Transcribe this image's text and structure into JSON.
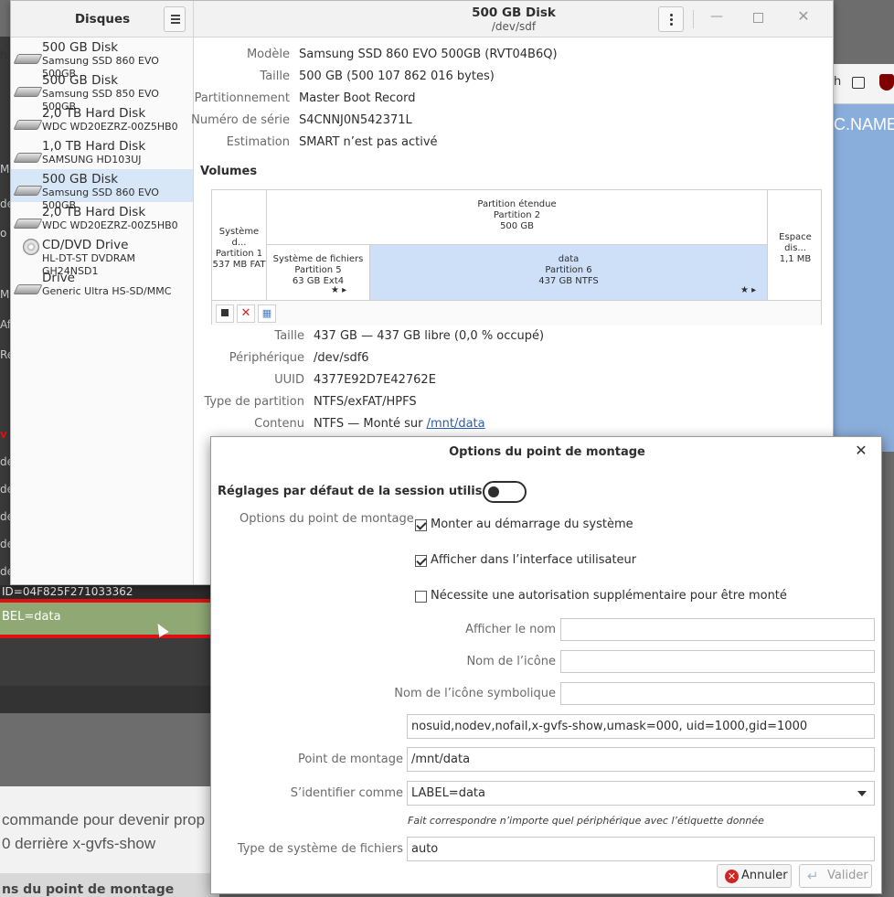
{
  "background": {
    "left_edge": [
      "h",
      "M",
      "de",
      "o",
      "Mo",
      "Af",
      "Ré",
      "v",
      "dev/",
      "dev/",
      "dev/",
      "dev/",
      "dev/"
    ],
    "uuid_line": "ID=04F825F271033362",
    "label_line": "BEL=data",
    "text_line1": "commande pour devenir prop",
    "text_line2": "0 derrière x-gvfs-show",
    "bottom_title": "ns du point de montage",
    "browser_text": "C.NAME",
    "browser_edge": "h"
  },
  "sidebar": {
    "title": "Disques",
    "disks": [
      {
        "name": "500 GB Disk",
        "model": "Samsung SSD 860 EVO 500GB",
        "icon": "hdd-icon"
      },
      {
        "name": "500 GB Disk",
        "model": "Samsung SSD 850 EVO 500GB",
        "icon": "hdd-icon"
      },
      {
        "name": "2,0 TB Hard Disk",
        "model": "WDC WD20EZRZ-00Z5HB0",
        "icon": "hdd-icon"
      },
      {
        "name": "1,0 TB Hard Disk",
        "model": "SAMSUNG HD103UJ",
        "icon": "hdd-icon"
      },
      {
        "name": "500 GB Disk",
        "model": "Samsung SSD 860 EVO 500GB",
        "icon": "hdd-icon"
      },
      {
        "name": "2,0 TB Hard Disk",
        "model": "WDC WD20EZRZ-00Z5HB0",
        "icon": "hdd-icon"
      },
      {
        "name": "CD/DVD Drive",
        "model": "HL-DT-ST DVDRAM GH24NSD1",
        "icon": "cd-icon"
      },
      {
        "name": "Drive",
        "model": "Generic Ultra HS-SD/MMC",
        "icon": "hdd-icon"
      }
    ]
  },
  "header": {
    "title": "500 GB Disk",
    "subtitle": "/dev/sdf"
  },
  "disk_info": [
    {
      "key": "Modèle",
      "value": "Samsung SSD 860 EVO 500GB (RVT04B6Q)"
    },
    {
      "key": "Taille",
      "value": "500 GB (500 107 862 016 bytes)"
    },
    {
      "key": "Partitionnement",
      "value": "Master Boot Record"
    },
    {
      "key": "Numéro de série",
      "value": "S4CNNJ0N542371L"
    },
    {
      "key": "Estimation",
      "value": "SMART n’est pas activé"
    }
  ],
  "volumes": {
    "title": "Volumes",
    "p1": {
      "line1": "Système d...",
      "line2": "Partition 1",
      "line3": "537 MB FAT"
    },
    "ext": {
      "line1": "Partition étendue",
      "line2": "Partition 2",
      "line3": "500 GB"
    },
    "p5": {
      "line1": "Système de fichiers",
      "line2": "Partition 5",
      "line3": "63 GB Ext4"
    },
    "p6": {
      "line1": "data",
      "line2": "Partition 6",
      "line3": "437 GB NTFS"
    },
    "free": {
      "line1": "Espace dis...",
      "line2": "1,1 MB"
    }
  },
  "volume_info": [
    {
      "key": "Taille",
      "value": "437 GB — 437 GB libre (0,0 % occupé)"
    },
    {
      "key": "Périphérique",
      "value": "/dev/sdf6"
    },
    {
      "key": "UUID",
      "value": "4377E92D7E42762E"
    },
    {
      "key": "Type de partition",
      "value": "NTFS/exFAT/HPFS"
    },
    {
      "key": "Contenu",
      "value": "NTFS — Monté sur ",
      "link": "/mnt/data"
    }
  ],
  "dialog": {
    "title": "Options du point de montage",
    "defaults_label": "Réglages par défaut de la session utilisateur",
    "defaults_on": false,
    "options_label": "Options du point de montage",
    "check_boot": "Monter au démarrage du système",
    "check_boot_on": true,
    "check_ui": "Afficher dans l’interface utilisateur",
    "check_ui_on": true,
    "check_auth": "Nécessite une autorisation supplémentaire pour être monté",
    "check_auth_on": false,
    "name_label": "Afficher le nom",
    "name_value": "",
    "icon_label": "Nom de l’icône",
    "icon_value": "",
    "symicon_label": "Nom de l’icône symbolique",
    "symicon_value": "",
    "options_value": "nosuid,nodev,nofail,x-gvfs-show,umask=000, uid=1000,gid=1000",
    "mountpoint_label": "Point de montage",
    "mountpoint_value": "/mnt/data",
    "identify_label": "S’identifier comme",
    "identify_value": "LABEL=data",
    "identify_hint": "Fait correspondre n’importe quel périphérique avec l’étiquette donnée",
    "fstype_label": "Type de système de fichiers",
    "fstype_value": "auto",
    "cancel_label": "Annuler",
    "ok_label": "Valider"
  }
}
